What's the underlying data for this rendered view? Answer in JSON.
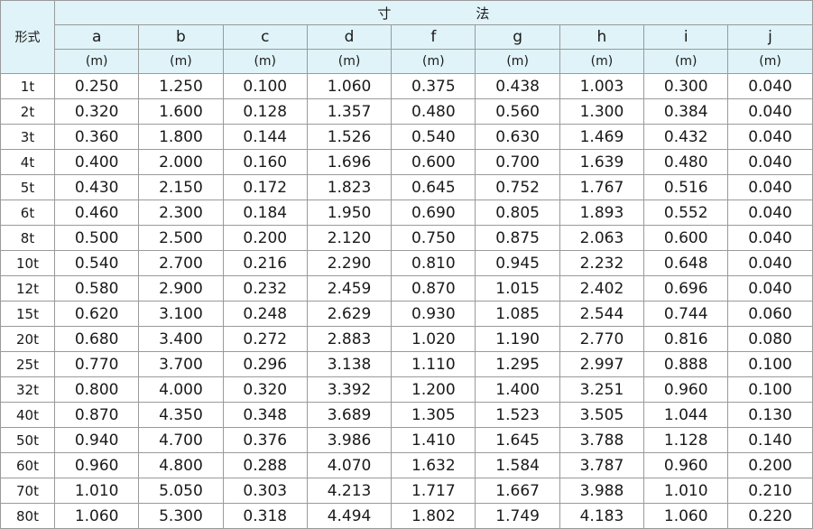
{
  "table": {
    "type_header": "形式",
    "group_header_left": "寸",
    "group_header_right": "法",
    "columns": [
      {
        "letter": "a",
        "unit": "(m)"
      },
      {
        "letter": "b",
        "unit": "(m)"
      },
      {
        "letter": "c",
        "unit": "(m)"
      },
      {
        "letter": "d",
        "unit": "(m)"
      },
      {
        "letter": "f",
        "unit": "(m)"
      },
      {
        "letter": "g",
        "unit": "(m)"
      },
      {
        "letter": "h",
        "unit": "(m)"
      },
      {
        "letter": "i",
        "unit": "(m)"
      },
      {
        "letter": "j",
        "unit": "(m)"
      }
    ],
    "rows": [
      {
        "type": "1t",
        "values": [
          "0.250",
          "1.250",
          "0.100",
          "1.060",
          "0.375",
          "0.438",
          "1.003",
          "0.300",
          "0.040"
        ]
      },
      {
        "type": "2t",
        "values": [
          "0.320",
          "1.600",
          "0.128",
          "1.357",
          "0.480",
          "0.560",
          "1.300",
          "0.384",
          "0.040"
        ]
      },
      {
        "type": "3t",
        "values": [
          "0.360",
          "1.800",
          "0.144",
          "1.526",
          "0.540",
          "0.630",
          "1.469",
          "0.432",
          "0.040"
        ]
      },
      {
        "type": "4t",
        "values": [
          "0.400",
          "2.000",
          "0.160",
          "1.696",
          "0.600",
          "0.700",
          "1.639",
          "0.480",
          "0.040"
        ]
      },
      {
        "type": "5t",
        "values": [
          "0.430",
          "2.150",
          "0.172",
          "1.823",
          "0.645",
          "0.752",
          "1.767",
          "0.516",
          "0.040"
        ]
      },
      {
        "type": "6t",
        "values": [
          "0.460",
          "2.300",
          "0.184",
          "1.950",
          "0.690",
          "0.805",
          "1.893",
          "0.552",
          "0.040"
        ]
      },
      {
        "type": "8t",
        "values": [
          "0.500",
          "2.500",
          "0.200",
          "2.120",
          "0.750",
          "0.875",
          "2.063",
          "0.600",
          "0.040"
        ]
      },
      {
        "type": "10t",
        "values": [
          "0.540",
          "2.700",
          "0.216",
          "2.290",
          "0.810",
          "0.945",
          "2.232",
          "0.648",
          "0.040"
        ]
      },
      {
        "type": "12t",
        "values": [
          "0.580",
          "2.900",
          "0.232",
          "2.459",
          "0.870",
          "1.015",
          "2.402",
          "0.696",
          "0.040"
        ]
      },
      {
        "type": "15t",
        "values": [
          "0.620",
          "3.100",
          "0.248",
          "2.629",
          "0.930",
          "1.085",
          "2.544",
          "0.744",
          "0.060"
        ]
      },
      {
        "type": "20t",
        "values": [
          "0.680",
          "3.400",
          "0.272",
          "2.883",
          "1.020",
          "1.190",
          "2.770",
          "0.816",
          "0.080"
        ]
      },
      {
        "type": "25t",
        "values": [
          "0.770",
          "3.700",
          "0.296",
          "3.138",
          "1.110",
          "1.295",
          "2.997",
          "0.888",
          "0.100"
        ]
      },
      {
        "type": "32t",
        "values": [
          "0.800",
          "4.000",
          "0.320",
          "3.392",
          "1.200",
          "1.400",
          "3.251",
          "0.960",
          "0.100"
        ]
      },
      {
        "type": "40t",
        "values": [
          "0.870",
          "4.350",
          "0.348",
          "3.689",
          "1.305",
          "1.523",
          "3.505",
          "1.044",
          "0.130"
        ]
      },
      {
        "type": "50t",
        "values": [
          "0.940",
          "4.700",
          "0.376",
          "3.986",
          "1.410",
          "1.645",
          "3.788",
          "1.128",
          "0.140"
        ]
      },
      {
        "type": "60t",
        "values": [
          "0.960",
          "4.800",
          "0.288",
          "4.070",
          "1.632",
          "1.584",
          "3.787",
          "0.960",
          "0.200"
        ]
      },
      {
        "type": "70t",
        "values": [
          "1.010",
          "5.050",
          "0.303",
          "4.213",
          "1.717",
          "1.667",
          "3.988",
          "1.010",
          "0.210"
        ]
      },
      {
        "type": "80t",
        "values": [
          "1.060",
          "5.300",
          "0.318",
          "4.494",
          "1.802",
          "1.749",
          "4.183",
          "1.060",
          "0.220"
        ]
      }
    ]
  }
}
